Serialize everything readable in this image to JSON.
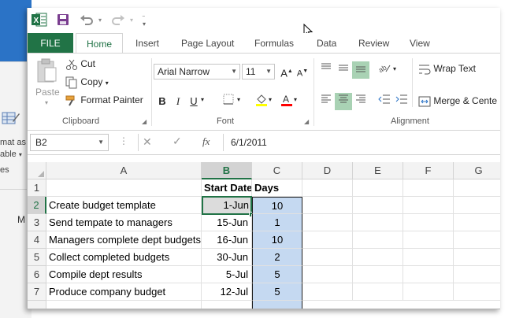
{
  "background_app": {
    "line1": "mat as",
    "line2": "able",
    "line3": "es",
    "col_letter": "M"
  },
  "titlebar": {
    "app_icon": "excel-icon"
  },
  "tabs": [
    {
      "label": "FILE"
    },
    {
      "label": "Home"
    },
    {
      "label": "Insert"
    },
    {
      "label": "Page Layout"
    },
    {
      "label": "Formulas"
    },
    {
      "label": "Data"
    },
    {
      "label": "Review"
    },
    {
      "label": "View"
    }
  ],
  "ribbon": {
    "clipboard": {
      "paste": "Paste",
      "cut": "Cut",
      "copy": "Copy",
      "format_painter": "Format Painter",
      "label": "Clipboard"
    },
    "font": {
      "font_name": "Arial Narrow",
      "font_size": "11",
      "bold": "B",
      "italic": "I",
      "underline": "U",
      "label": "Font",
      "fill_color": "#ffff00",
      "font_color": "#ff0000"
    },
    "alignment": {
      "wrap_text": "Wrap Text",
      "merge_center": "Merge & Cente",
      "label": "Alignment"
    }
  },
  "formula_bar": {
    "name_box": "B2",
    "fx": "fx",
    "formula": "6/1/2011"
  },
  "grid": {
    "columns": [
      "A",
      "B",
      "C",
      "D",
      "E",
      "F",
      "G"
    ],
    "rows": [
      {
        "num": "1",
        "a": "",
        "b": "Start Date",
        "c": "Days"
      },
      {
        "num": "2",
        "a": "Create budget template",
        "b": "1-Jun",
        "c": "10"
      },
      {
        "num": "3",
        "a": "Send tempate to managers",
        "b": "15-Jun",
        "c": "1"
      },
      {
        "num": "4",
        "a": "Managers complete dept budgets",
        "b": "16-Jun",
        "c": "10"
      },
      {
        "num": "5",
        "a": "Collect completed budgets",
        "b": "30-Jun",
        "c": "2"
      },
      {
        "num": "6",
        "a": "Compile dept results",
        "b": "5-Jul",
        "c": "5"
      },
      {
        "num": "7",
        "a": "Produce company budget",
        "b": "12-Jul",
        "c": "5"
      }
    ],
    "selected_cell": "B2"
  },
  "colors": {
    "excel_green": "#217346",
    "highlight_blue": "#c5d9f1"
  }
}
